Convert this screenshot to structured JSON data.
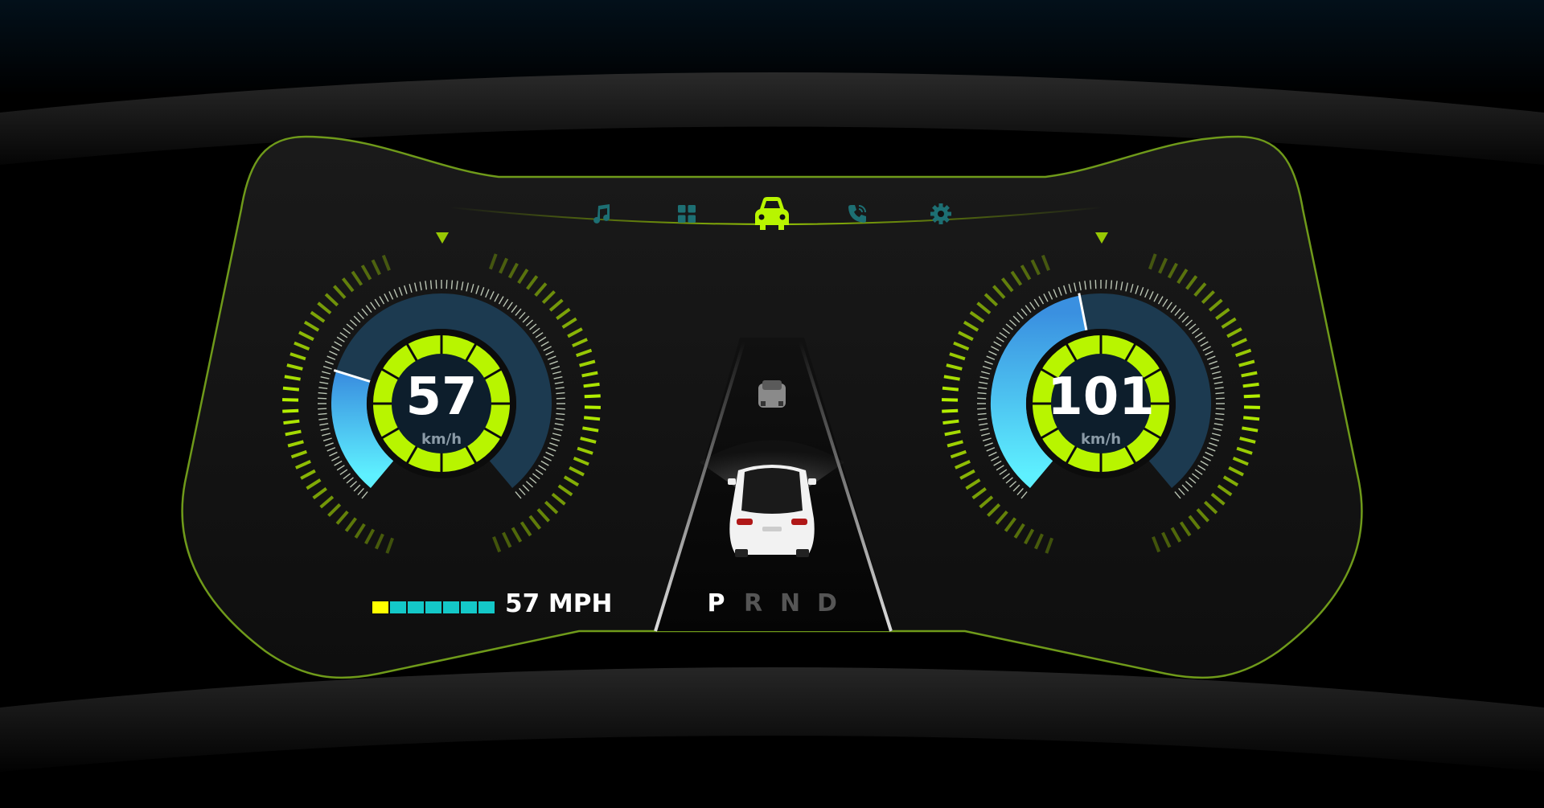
{
  "nav": {
    "items": [
      {
        "name": "music",
        "icon": "music-note-icon",
        "active": false
      },
      {
        "name": "apps",
        "icon": "grid-icon",
        "active": false
      },
      {
        "name": "car",
        "icon": "car-icon",
        "active": true
      },
      {
        "name": "phone",
        "icon": "phone-icon",
        "active": false
      },
      {
        "name": "settings",
        "icon": "gear-icon",
        "active": false
      }
    ]
  },
  "left_gauge": {
    "value": "57",
    "unit": "km/h",
    "level": 0.24
  },
  "right_gauge": {
    "value": "101",
    "unit": "km/h",
    "level": 0.46
  },
  "mph": {
    "text": "57 MPH",
    "bar_segments": [
      "#ffff00",
      "#14c8c8",
      "#14c8c8",
      "#14c8c8",
      "#14c8c8",
      "#14c8c8",
      "#14c8c8"
    ]
  },
  "gears": {
    "items": [
      "P",
      "R",
      "N",
      "D"
    ],
    "active": "P"
  },
  "colors": {
    "accent": "#b8f500",
    "active_gear": "#ffffff",
    "inactive_gear": "#555555",
    "gauge_fill": "#5ad8ff",
    "gauge_track": "#1c3a50",
    "nav_inactive": "#1d6f73"
  }
}
